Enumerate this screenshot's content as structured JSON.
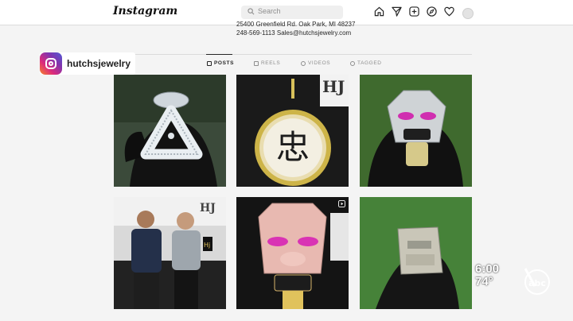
{
  "app": {
    "name": "Instagram"
  },
  "search": {
    "placeholder": "Search"
  },
  "profile": {
    "username": "hutchsjewelry",
    "address": "25400 Greenfield Rd. Oak Park, MI 48237",
    "contact": "248-569-1113 Sales@hutchsjewelry.com"
  },
  "tabs": [
    {
      "label": "POSTS",
      "active": true
    },
    {
      "label": "REELS",
      "active": false
    },
    {
      "label": "VIDEOS",
      "active": false
    },
    {
      "label": "TAGGED",
      "active": false
    }
  ],
  "posts": [
    {
      "subject": "recycle-symbol-pendant",
      "type": "image"
    },
    {
      "subject": "chinese-character-medallion",
      "type": "image",
      "text": "忠"
    },
    {
      "subject": "pig-head-pendant-purple-eyes",
      "type": "image"
    },
    {
      "subject": "two-men-in-store",
      "type": "image",
      "brand_mark": "HJ"
    },
    {
      "subject": "pig-head-pendant-closeup",
      "type": "reel"
    },
    {
      "subject": "custom-pendant-on-grass",
      "type": "image"
    }
  ],
  "overlay": {
    "time": "6:00",
    "temperature": "74°",
    "station": "abc"
  },
  "colors": {
    "accent": "#262626",
    "muted": "#8e8e8e",
    "border": "#dbdbdb"
  }
}
